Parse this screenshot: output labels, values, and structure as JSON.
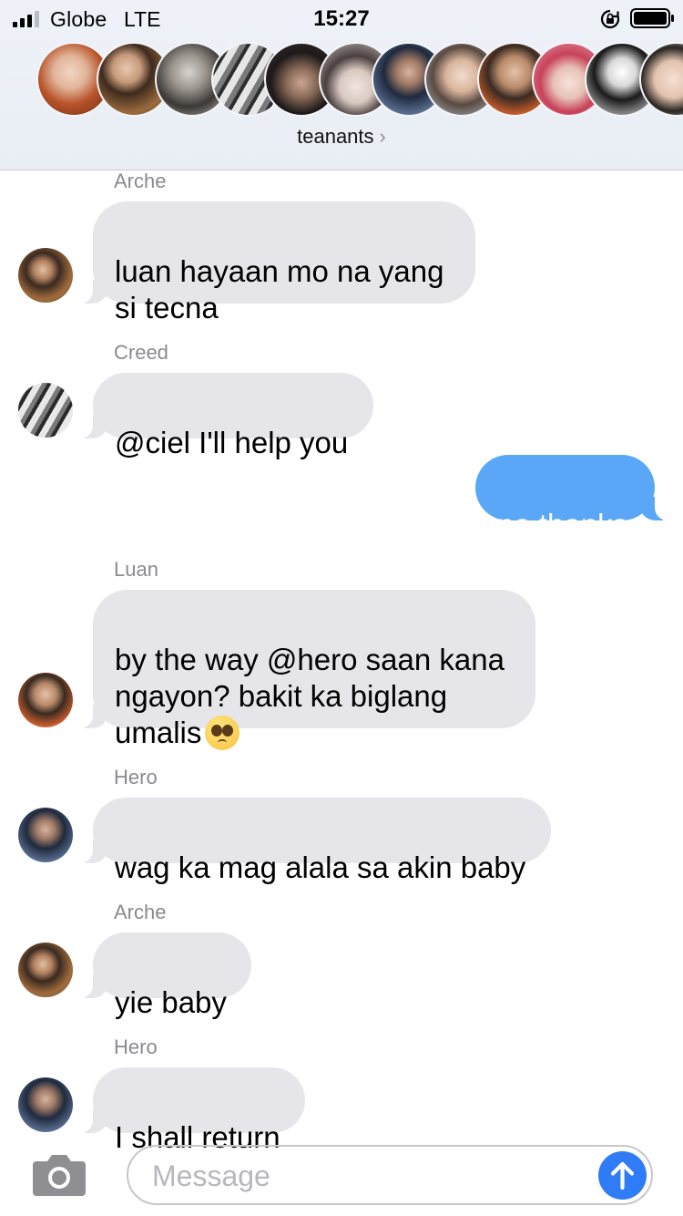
{
  "status_bar": {
    "carrier": "Globe",
    "network": "LTE",
    "time": "15:27",
    "signal_bars_active": 3,
    "signal_bars_total": 4,
    "icons": [
      "orientation-lock-icon",
      "battery-icon"
    ]
  },
  "conversation": {
    "group_name": "teanants",
    "chevron": "›",
    "member_avatar_count": 14
  },
  "colors": {
    "outgoing_bubble": "#5aa7f7",
    "incoming_bubble": "#e5e5ea",
    "send_button": "#2f7cf6",
    "sender_label": "#8a8a8f"
  },
  "messages": [
    {
      "sender": "Arche",
      "text": "luan hayaan mo na yang\nsi tecna",
      "direction": "incoming"
    },
    {
      "sender": "Creed",
      "text": "@ciel I'll help you",
      "direction": "incoming"
    },
    {
      "sender": "",
      "text": "no thanks",
      "direction": "outgoing"
    },
    {
      "sender": "Luan",
      "text": "by the way @hero saan kana\nngayon? bakit ka biglang\numalis",
      "emoji": "pleading-face-emoji",
      "direction": "incoming"
    },
    {
      "sender": "Hero",
      "text": "wag ka mag alala sa akin baby",
      "direction": "incoming"
    },
    {
      "sender": "Arche",
      "text": "yie baby",
      "direction": "incoming"
    },
    {
      "sender": "Hero",
      "text": "I shall return",
      "direction": "incoming"
    }
  ],
  "input_bar": {
    "placeholder": "Message",
    "camera_icon": "camera-icon",
    "send_icon": "arrow-up-icon"
  }
}
